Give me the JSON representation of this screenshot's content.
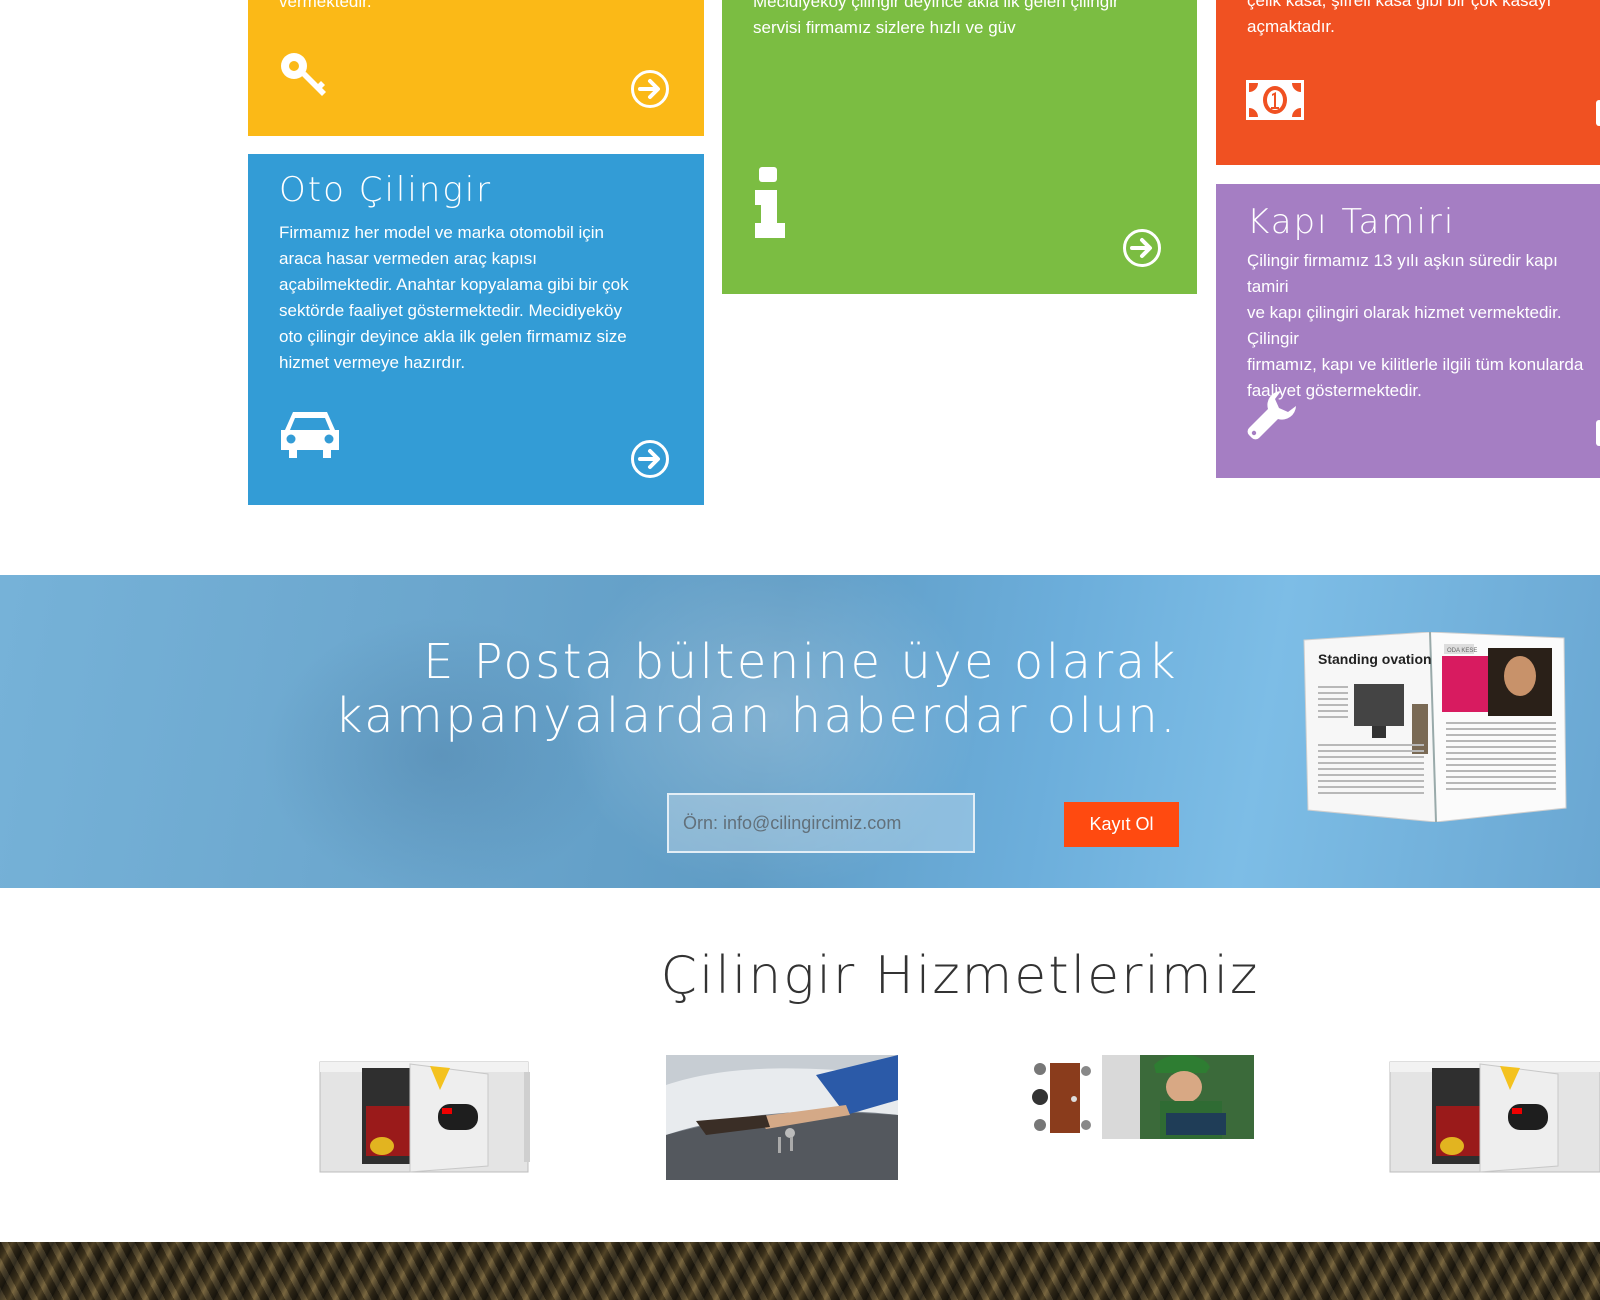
{
  "tiles": {
    "yellow": {
      "text": "vermektedir.",
      "icon": "key-icon",
      "color": "#fbb917"
    },
    "green": {
      "text": "Mecidiyeköy çilingir deyince akla ilk gelen çilingir\nservisi firmamız sizlere hızlı ve güv",
      "icon": "info-icon",
      "color": "#7bbd42"
    },
    "red": {
      "text": "çelik kasa, şifreli kasa gibi bir çok kasayı\naçmaktadır.",
      "icon": "money-icon",
      "color": "#f05122"
    },
    "blue": {
      "title": "Oto Çilingir",
      "text": "Firmamız her model ve marka otomobil için\naraca hasar vermeden araç kapısı\naçabilmektedir. Anahtar kopyalama gibi bir çok\nsektörde faaliyet göstermektedir. Mecidiyeköy\noto çilingir deyince akla ilk gelen firmamız size\nhizmet vermeye hazırdır.",
      "icon": "car-icon",
      "color": "#339cd6"
    },
    "purple": {
      "title": "Kapı Tamiri",
      "text": "Çilingir firmamız 13 yılı aşkın süredir kapı tamiri\nve kapı çilingiri olarak hizmet vermektedir. Çilingir\nfirmamız, kapı ve kilitlerle ilgili tüm konularda\nfaaliyet göstermektedir.",
      "icon": "wrench-icon",
      "color": "#a57ec3"
    }
  },
  "newsletter": {
    "title": "E Posta bültenine üye olarak\nkampanyalardan haberdar olun.",
    "email_placeholder": "Örn: info@cilingircimiz.com",
    "email_value": "",
    "signup_label": "Kayıt Ol",
    "magazine_headline": "Standing ovation",
    "magazine_tag": "ODA KESE",
    "accent": "#ff4a10"
  },
  "services": {
    "title": "Çilingir Hizmetlerimiz"
  }
}
